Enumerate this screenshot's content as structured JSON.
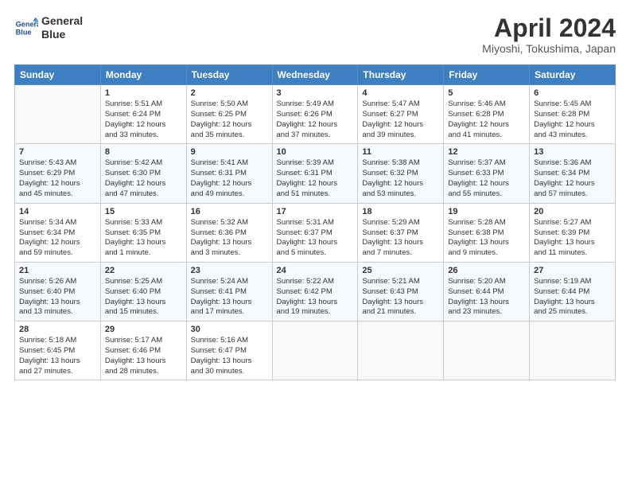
{
  "header": {
    "logo_line1": "General",
    "logo_line2": "Blue",
    "month_title": "April 2024",
    "location": "Miyoshi, Tokushima, Japan"
  },
  "weekdays": [
    "Sunday",
    "Monday",
    "Tuesday",
    "Wednesday",
    "Thursday",
    "Friday",
    "Saturday"
  ],
  "weeks": [
    [
      {
        "num": "",
        "info": ""
      },
      {
        "num": "1",
        "info": "Sunrise: 5:51 AM\nSunset: 6:24 PM\nDaylight: 12 hours\nand 33 minutes."
      },
      {
        "num": "2",
        "info": "Sunrise: 5:50 AM\nSunset: 6:25 PM\nDaylight: 12 hours\nand 35 minutes."
      },
      {
        "num": "3",
        "info": "Sunrise: 5:49 AM\nSunset: 6:26 PM\nDaylight: 12 hours\nand 37 minutes."
      },
      {
        "num": "4",
        "info": "Sunrise: 5:47 AM\nSunset: 6:27 PM\nDaylight: 12 hours\nand 39 minutes."
      },
      {
        "num": "5",
        "info": "Sunrise: 5:46 AM\nSunset: 6:28 PM\nDaylight: 12 hours\nand 41 minutes."
      },
      {
        "num": "6",
        "info": "Sunrise: 5:45 AM\nSunset: 6:28 PM\nDaylight: 12 hours\nand 43 minutes."
      }
    ],
    [
      {
        "num": "7",
        "info": "Sunrise: 5:43 AM\nSunset: 6:29 PM\nDaylight: 12 hours\nand 45 minutes."
      },
      {
        "num": "8",
        "info": "Sunrise: 5:42 AM\nSunset: 6:30 PM\nDaylight: 12 hours\nand 47 minutes."
      },
      {
        "num": "9",
        "info": "Sunrise: 5:41 AM\nSunset: 6:31 PM\nDaylight: 12 hours\nand 49 minutes."
      },
      {
        "num": "10",
        "info": "Sunrise: 5:39 AM\nSunset: 6:31 PM\nDaylight: 12 hours\nand 51 minutes."
      },
      {
        "num": "11",
        "info": "Sunrise: 5:38 AM\nSunset: 6:32 PM\nDaylight: 12 hours\nand 53 minutes."
      },
      {
        "num": "12",
        "info": "Sunrise: 5:37 AM\nSunset: 6:33 PM\nDaylight: 12 hours\nand 55 minutes."
      },
      {
        "num": "13",
        "info": "Sunrise: 5:36 AM\nSunset: 6:34 PM\nDaylight: 12 hours\nand 57 minutes."
      }
    ],
    [
      {
        "num": "14",
        "info": "Sunrise: 5:34 AM\nSunset: 6:34 PM\nDaylight: 12 hours\nand 59 minutes."
      },
      {
        "num": "15",
        "info": "Sunrise: 5:33 AM\nSunset: 6:35 PM\nDaylight: 13 hours\nand 1 minute."
      },
      {
        "num": "16",
        "info": "Sunrise: 5:32 AM\nSunset: 6:36 PM\nDaylight: 13 hours\nand 3 minutes."
      },
      {
        "num": "17",
        "info": "Sunrise: 5:31 AM\nSunset: 6:37 PM\nDaylight: 13 hours\nand 5 minutes."
      },
      {
        "num": "18",
        "info": "Sunrise: 5:29 AM\nSunset: 6:37 PM\nDaylight: 13 hours\nand 7 minutes."
      },
      {
        "num": "19",
        "info": "Sunrise: 5:28 AM\nSunset: 6:38 PM\nDaylight: 13 hours\nand 9 minutes."
      },
      {
        "num": "20",
        "info": "Sunrise: 5:27 AM\nSunset: 6:39 PM\nDaylight: 13 hours\nand 11 minutes."
      }
    ],
    [
      {
        "num": "21",
        "info": "Sunrise: 5:26 AM\nSunset: 6:40 PM\nDaylight: 13 hours\nand 13 minutes."
      },
      {
        "num": "22",
        "info": "Sunrise: 5:25 AM\nSunset: 6:40 PM\nDaylight: 13 hours\nand 15 minutes."
      },
      {
        "num": "23",
        "info": "Sunrise: 5:24 AM\nSunset: 6:41 PM\nDaylight: 13 hours\nand 17 minutes."
      },
      {
        "num": "24",
        "info": "Sunrise: 5:22 AM\nSunset: 6:42 PM\nDaylight: 13 hours\nand 19 minutes."
      },
      {
        "num": "25",
        "info": "Sunrise: 5:21 AM\nSunset: 6:43 PM\nDaylight: 13 hours\nand 21 minutes."
      },
      {
        "num": "26",
        "info": "Sunrise: 5:20 AM\nSunset: 6:44 PM\nDaylight: 13 hours\nand 23 minutes."
      },
      {
        "num": "27",
        "info": "Sunrise: 5:19 AM\nSunset: 6:44 PM\nDaylight: 13 hours\nand 25 minutes."
      }
    ],
    [
      {
        "num": "28",
        "info": "Sunrise: 5:18 AM\nSunset: 6:45 PM\nDaylight: 13 hours\nand 27 minutes."
      },
      {
        "num": "29",
        "info": "Sunrise: 5:17 AM\nSunset: 6:46 PM\nDaylight: 13 hours\nand 28 minutes."
      },
      {
        "num": "30",
        "info": "Sunrise: 5:16 AM\nSunset: 6:47 PM\nDaylight: 13 hours\nand 30 minutes."
      },
      {
        "num": "",
        "info": ""
      },
      {
        "num": "",
        "info": ""
      },
      {
        "num": "",
        "info": ""
      },
      {
        "num": "",
        "info": ""
      }
    ]
  ]
}
